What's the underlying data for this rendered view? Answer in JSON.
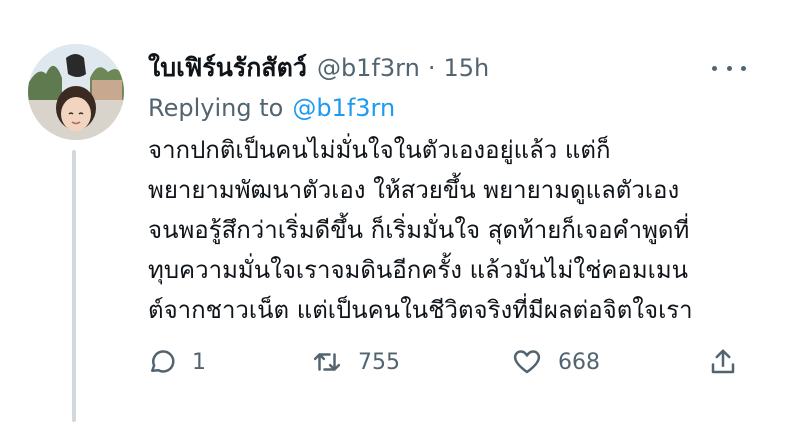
{
  "tweet": {
    "display_name": "ใบเฟิร์นรักสัตว์",
    "handle": "@b1f3rn",
    "separator": "·",
    "time": "15h",
    "replying_prefix": "Replying to",
    "replying_handle": "@b1f3rn",
    "body_lines": [
      "จากปกติเป็นคนไม่มั่นใจในตัวเองอยู่แล้ว แต่ก็",
      "พยายามพัฒนาตัวเอง ให้สวยขึ้น พยายามดูแลตัวเอง",
      "จนพอรู้สึกว่าเริ่มดีขึ้น ก็เริ่มมั่นใจ สุดท้ายก็เจอคำพูดที่",
      "ทุบความมั่นใจเราจมดินอีกครั้ง แล้วมันไม่ใช่คอมเมน",
      "ต์จากชาวเน็ต แต่เป็นคนในชีวิตจริงที่มีผลต่อจิตใจเรา"
    ]
  },
  "actions": {
    "reply": {
      "icon": "reply-icon",
      "count": "1"
    },
    "retweet": {
      "icon": "retweet-icon",
      "count": "755"
    },
    "like": {
      "icon": "heart-icon",
      "count": "668"
    },
    "share": {
      "icon": "share-icon"
    }
  },
  "colors": {
    "text": "#0f1419",
    "secondary": "#536471",
    "link": "#1d9bf0",
    "thread_line": "#cfd9de"
  }
}
